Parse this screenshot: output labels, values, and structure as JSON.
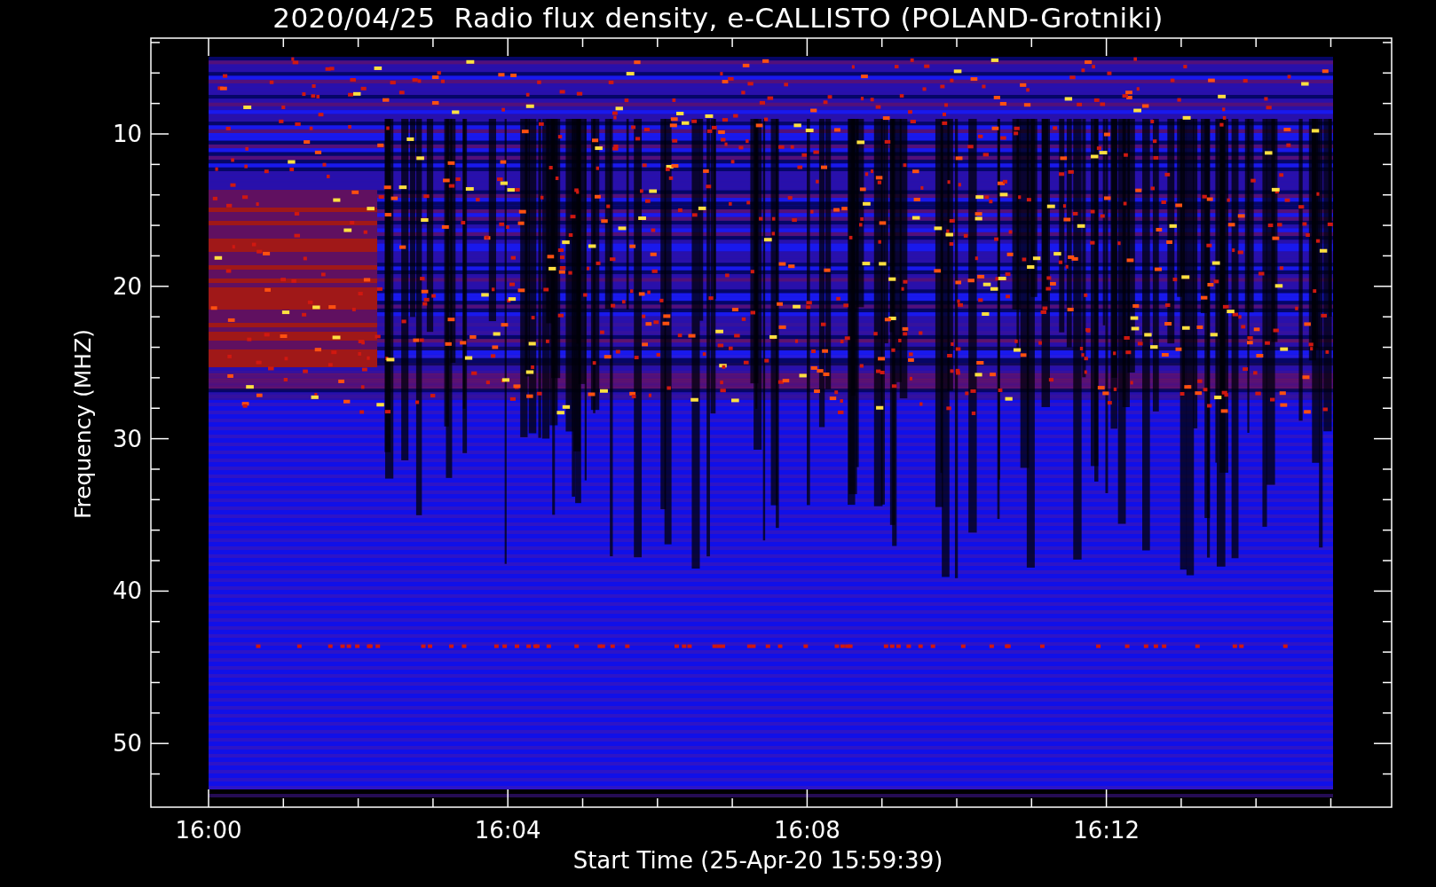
{
  "title": "2020/04/25  Radio flux density, e-CALLISTO (POLAND-Grotniki)",
  "y_axis": {
    "label": "Frequency (MHZ)",
    "ticks": [
      "10",
      "20",
      "30",
      "40",
      "50"
    ]
  },
  "x_axis": {
    "label": "Start Time (25-Apr-20 15:59:39)",
    "ticks": [
      "16:00",
      "16:04",
      "16:08",
      "16:12"
    ]
  }
}
